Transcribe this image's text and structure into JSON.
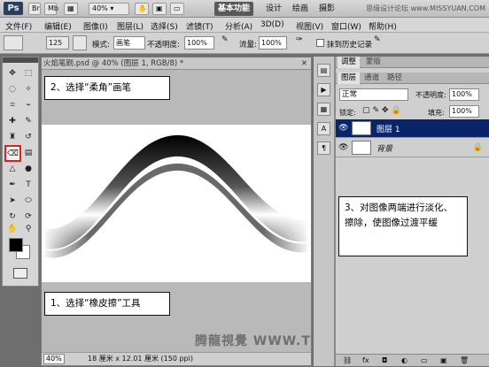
{
  "appbar": {
    "logo": "Ps",
    "zoom": "40%",
    "workspaces": [
      "基本功能",
      "设计",
      "绘画",
      "摄影"
    ],
    "watermark": "思缘设计论坛 www.MISSYUAN.COM"
  },
  "menu": [
    "文件(F)",
    "编辑(E)",
    "图像(I)",
    "图层(L)",
    "选择(S)",
    "滤镜(T)",
    "分析(A)",
    "3D(D)",
    "视图(V)",
    "窗口(W)",
    "帮助(H)"
  ],
  "options": {
    "brush_size": "125",
    "mode_label": "模式:",
    "mode_value": "画笔",
    "opacity_label": "不透明度:",
    "opacity_value": "100%",
    "flow_label": "流量:",
    "flow_value": "100%",
    "erase_history_label": "抹到历史记录"
  },
  "document": {
    "tab_title": "火焰笔刷.psd @ 40% (图层 1, RGB/8) *",
    "zoom": "40%",
    "doc_info": "18 厘米 x 12.01 厘米 (150 ppi)"
  },
  "callouts": {
    "step1": "1、选择“橡皮擦”工具",
    "step2": "2、选择“柔角”画笔",
    "step3": "3、对图像两端进行淡化、擦除，使图像过渡平缓"
  },
  "watermark_bottom": "腾龍視覺 WWW.TLVI.NET",
  "panel": {
    "tabs_top": [
      "调整",
      "蒙版"
    ],
    "tabs": [
      "图层",
      "通道",
      "路径"
    ],
    "blend_mode": "正常",
    "opacity_label": "不透明度:",
    "opacity_value": "100%",
    "lock_label": "锁定:",
    "fill_label": "填充:",
    "fill_value": "100%",
    "layers": [
      {
        "name": "图层 1",
        "selected": true
      },
      {
        "name": "背景",
        "selected": false
      }
    ]
  },
  "colors": {
    "highlight": "#e02020",
    "layer_selected": "#0a246a"
  }
}
